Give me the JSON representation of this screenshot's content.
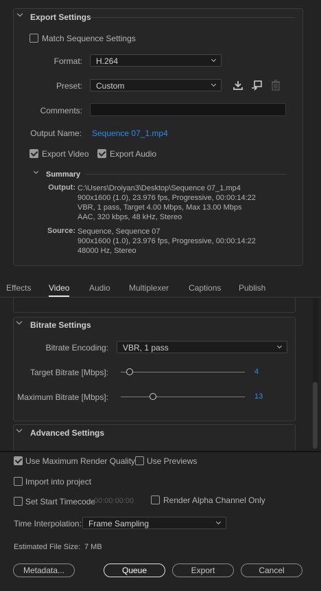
{
  "export_settings": {
    "title": "Export Settings",
    "match_sequence_label": "Match Sequence Settings",
    "match_sequence_checked": false,
    "format_label": "Format:",
    "format_value": "H.264",
    "preset_label": "Preset:",
    "preset_value": "Custom",
    "comments_label": "Comments:",
    "comments_value": "",
    "output_name_label": "Output Name:",
    "output_name_value": "Sequence 07_1.mp4",
    "export_video_label": "Export Video",
    "export_video_checked": true,
    "export_audio_label": "Export Audio",
    "export_audio_checked": true
  },
  "summary": {
    "title": "Summary",
    "output_key": "Output:",
    "output_lines": [
      "C:\\Users\\Droiyan3\\Desktop\\Sequence 07_1.mp4",
      "900x1600 (1.0), 23.976 fps, Progressive, 00:00:14:22",
      "VBR, 1 pass, Target 4.00 Mbps, Max 13.00 Mbps",
      "AAC, 320 kbps, 48 kHz, Stereo"
    ],
    "source_key": "Source:",
    "source_lines": [
      "Sequence, Sequence 07",
      "900x1600 (1.0), 23.976 fps, Progressive, 00:00:14:22",
      "48000 Hz, Stereo"
    ]
  },
  "tabs": [
    "Effects",
    "Video",
    "Audio",
    "Multiplexer",
    "Captions",
    "Publish"
  ],
  "active_tab": "Video",
  "bitrate": {
    "title": "Bitrate Settings",
    "encoding_label": "Bitrate Encoding:",
    "encoding_value": "VBR, 1 pass",
    "target_label": "Target Bitrate [Mbps]:",
    "target_value": "4",
    "target_fraction": 0.07,
    "max_label": "Maximum Bitrate [Mbps]:",
    "max_value": "13",
    "max_fraction": 0.26
  },
  "advanced": {
    "title": "Advanced Settings"
  },
  "bottom": {
    "max_render_label": "Use Maximum Render Quality",
    "max_render_checked": true,
    "use_previews_label": "Use Previews",
    "use_previews_checked": false,
    "import_label": "Import into project",
    "import_checked": false,
    "start_timecode_label": "Set Start Timecode",
    "start_timecode_checked": false,
    "start_timecode_value": "00:00:00:00",
    "render_alpha_label": "Render Alpha Channel Only",
    "render_alpha_checked": false,
    "interp_label": "Time Interpolation:",
    "interp_value": "Frame Sampling",
    "file_size_label": "Estimated File Size:",
    "file_size_value": "7 MB",
    "metadata_label": "Metadata...",
    "queue_label": "Queue",
    "export_label": "Export",
    "cancel_label": "Cancel"
  },
  "colors": {
    "accent_link": "#2d8ceb",
    "background": "#232323"
  }
}
